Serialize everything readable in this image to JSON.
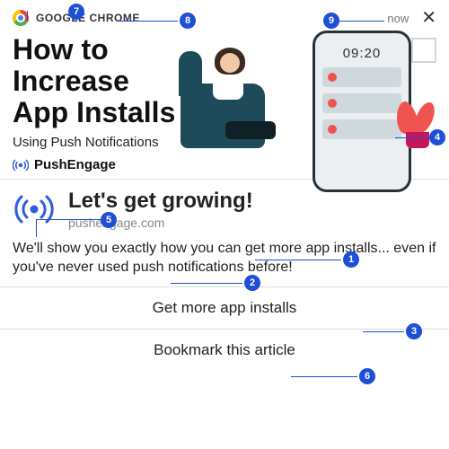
{
  "topbar": {
    "app": "GOOGLE CHROME",
    "time": "now",
    "close": "✕"
  },
  "hero": {
    "title_l1": "How to",
    "title_l2": "Increase",
    "title_l3": "App Installs",
    "subtitle": "Using Push Notifications",
    "phone_time": "09:20",
    "alert": "!"
  },
  "brand": "PushEngage",
  "card": {
    "title": "Let's get growing!",
    "domain": "pushengage.com",
    "desc": "We'll show you exactly how you can get more app installs... even if you've never used push notifications before!"
  },
  "actions": [
    "Get more app installs",
    "Bookmark this article"
  ],
  "callouts": {
    "1": "1",
    "2": "2",
    "3": "3",
    "4": "4",
    "5": "5",
    "6": "6",
    "7": "7",
    "8": "8",
    "9": "9"
  }
}
